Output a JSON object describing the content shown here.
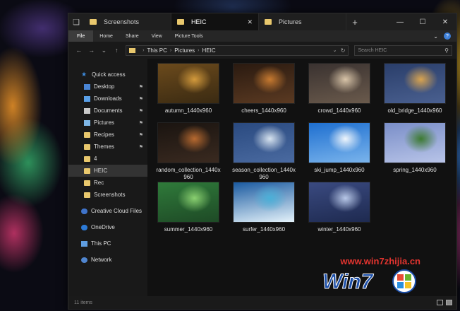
{
  "tabs": [
    {
      "label": "Screenshots",
      "active": false
    },
    {
      "label": "HEIC",
      "active": true
    },
    {
      "label": "Pictures",
      "active": false
    }
  ],
  "ribbon": {
    "tabs": [
      "File",
      "Home",
      "Share",
      "View",
      "Picture Tools"
    ],
    "help": "?"
  },
  "address": {
    "path": [
      "This PC",
      "Pictures",
      "HEIC"
    ]
  },
  "search": {
    "placeholder": "Search HEIC"
  },
  "nav_pane": [
    {
      "label": "Quick access",
      "icon": "star-icon",
      "pinned": false
    },
    {
      "label": "Desktop",
      "icon": "desktop-icon",
      "pinned": true
    },
    {
      "label": "Downloads",
      "icon": "download-icon",
      "pinned": true
    },
    {
      "label": "Documents",
      "icon": "documents-icon",
      "pinned": true
    },
    {
      "label": "Pictures",
      "icon": "pictures-icon",
      "pinned": true
    },
    {
      "label": "Recipes",
      "icon": "folder-icon",
      "pinned": true
    },
    {
      "label": "Themes",
      "icon": "folder-icon",
      "pinned": true
    },
    {
      "label": "4",
      "icon": "folder-icon",
      "pinned": false
    },
    {
      "label": "HEIC",
      "icon": "folder-icon",
      "pinned": false,
      "selected": true
    },
    {
      "label": "Rec",
      "icon": "folder-icon",
      "pinned": false
    },
    {
      "label": "Screenshots",
      "icon": "folder-icon",
      "pinned": false
    },
    {
      "label": "Creative Cloud Files",
      "icon": "creative-cloud-icon",
      "pinned": false
    },
    {
      "label": "OneDrive",
      "icon": "onedrive-icon",
      "pinned": false
    },
    {
      "label": "This PC",
      "icon": "this-pc-icon",
      "pinned": false
    },
    {
      "label": "Network",
      "icon": "network-icon",
      "pinned": false
    }
  ],
  "files": [
    {
      "name": "autumn_1440x960",
      "colors": [
        "#6b4a1c",
        "#d39a3c",
        "#3a2a12"
      ]
    },
    {
      "name": "cheers_1440x960",
      "colors": [
        "#2a1a10",
        "#c77a30",
        "#5b3a22"
      ]
    },
    {
      "name": "crowd_1440x960",
      "colors": [
        "#3a3230",
        "#d8c4a8",
        "#6a5a4c"
      ]
    },
    {
      "name": "old_bridge_1440x960",
      "colors": [
        "#2a3e6a",
        "#d9a450",
        "#4a6090"
      ]
    },
    {
      "name": "random_collection_1440x960",
      "colors": [
        "#1a1410",
        "#b86a30",
        "#3a2a20"
      ]
    },
    {
      "name": "season_collection_1440x960",
      "colors": [
        "#2a4a80",
        "#d8e4f0",
        "#4a6aa0"
      ]
    },
    {
      "name": "ski_jump_1440x960",
      "colors": [
        "#1e6fd0",
        "#f0f6fc",
        "#7ab4ec"
      ]
    },
    {
      "name": "spring_1440x960",
      "colors": [
        "#7a8ec8",
        "#3c7a30",
        "#b8c4e8"
      ]
    },
    {
      "name": "summer_1440x960",
      "colors": [
        "#2f7a3a",
        "#8ad070",
        "#1e4a26"
      ]
    },
    {
      "name": "surfer_1440x960",
      "colors": [
        "#1a5aa0",
        "#4ab0d8",
        "#e4f2fa"
      ]
    },
    {
      "name": "winter_1440x960",
      "colors": [
        "#3a4a80",
        "#b8c8e8",
        "#1e2a50"
      ]
    }
  ],
  "status": {
    "count": "11 items"
  },
  "watermark": {
    "url": "www.win7zhijia.cn"
  }
}
